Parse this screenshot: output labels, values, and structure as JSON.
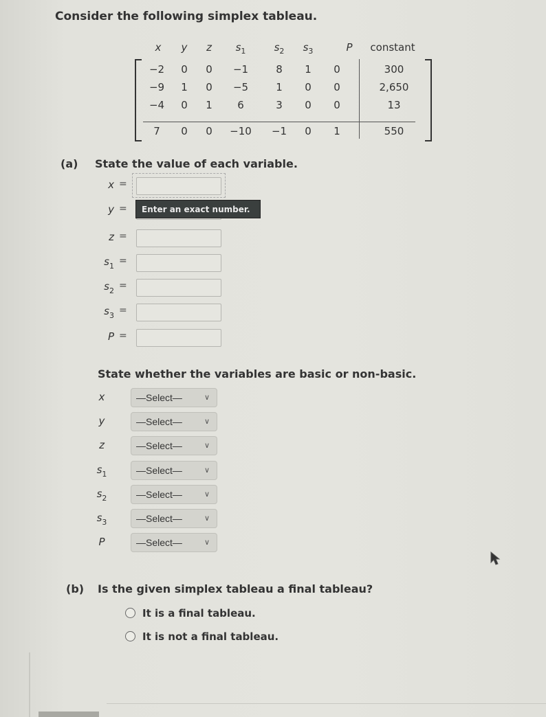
{
  "intro": "Consider the following simplex tableau.",
  "tableau": {
    "columns": [
      {
        "base": "x",
        "sub": ""
      },
      {
        "base": "y",
        "sub": ""
      },
      {
        "base": "z",
        "sub": ""
      },
      {
        "base": "s",
        "sub": "1"
      },
      {
        "base": "s",
        "sub": "2"
      },
      {
        "base": "s",
        "sub": "3"
      },
      {
        "base": "P",
        "sub": ""
      }
    ],
    "constant_label": "constant",
    "rows": [
      {
        "coeffs": [
          "−2",
          "0",
          "0",
          "−1",
          "8",
          "1",
          "0"
        ],
        "constant": "300"
      },
      {
        "coeffs": [
          "−9",
          "1",
          "0",
          "−5",
          "1",
          "0",
          "0"
        ],
        "constant": "2,650"
      },
      {
        "coeffs": [
          "−4",
          "0",
          "1",
          "6",
          "3",
          "0",
          "0"
        ],
        "constant": "13"
      },
      {
        "coeffs": [
          "7",
          "0",
          "0",
          "−10",
          "−1",
          "0",
          "1"
        ],
        "constant": "550"
      }
    ]
  },
  "part_a": {
    "label": "(a)",
    "prompt": "State the value of each variable.",
    "tooltip": "Enter an exact number.",
    "variables": [
      {
        "base": "x",
        "sub": "",
        "value": ""
      },
      {
        "base": "y",
        "sub": "",
        "value": ""
      },
      {
        "base": "z",
        "sub": "",
        "value": ""
      },
      {
        "base": "s",
        "sub": "1",
        "value": ""
      },
      {
        "base": "s",
        "sub": "2",
        "value": ""
      },
      {
        "base": "s",
        "sub": "3",
        "value": ""
      },
      {
        "base": "P",
        "sub": "",
        "value": ""
      }
    ],
    "equals": "=",
    "basic_prompt": "State whether the variables are basic or non-basic.",
    "selects": [
      {
        "base": "x",
        "sub": "",
        "selected": "—Select—"
      },
      {
        "base": "y",
        "sub": "",
        "selected": "—Select—"
      },
      {
        "base": "z",
        "sub": "",
        "selected": "—Select—"
      },
      {
        "base": "s",
        "sub": "1",
        "selected": "—Select—"
      },
      {
        "base": "s",
        "sub": "2",
        "selected": "—Select—"
      },
      {
        "base": "s",
        "sub": "3",
        "selected": "—Select—"
      },
      {
        "base": "P",
        "sub": "",
        "selected": "—Select—"
      }
    ]
  },
  "part_b": {
    "label": "(b)",
    "prompt": "Is the given simplex tableau a final tableau?",
    "options": [
      {
        "label": "It is a final tableau.",
        "checked": false
      },
      {
        "label": "It is not a final tableau.",
        "checked": false
      }
    ]
  },
  "icons": {
    "chevron": "chevron-down-icon",
    "cursor": "mouse-pointer-icon"
  }
}
